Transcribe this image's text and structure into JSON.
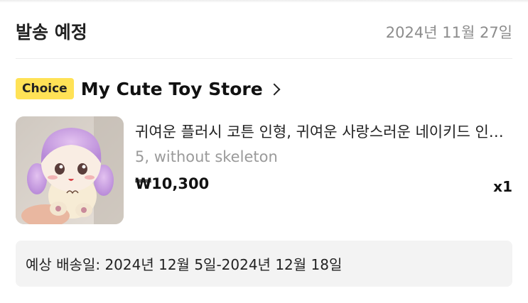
{
  "order": {
    "status": "발송 예정",
    "date": "2024년 11월 27일"
  },
  "store": {
    "badge": "Choice",
    "name": "My Cute Toy Store"
  },
  "item": {
    "title": "귀여운 플러시 코튼 인형, 귀여운 사랑스러운 네이키드 인형 장난감",
    "variant": "5, without skeleton",
    "price": "₩10,300",
    "quantity": "x1",
    "image_icon": "plush-doll-image"
  },
  "delivery": {
    "estimate": "예상 배송일: 2024년 12월 5일-2024년 12월 18일"
  },
  "colors": {
    "badge_bg": "#ffe256",
    "muted_text": "#8c8c8c",
    "panel_bg": "#f3f3f3"
  }
}
